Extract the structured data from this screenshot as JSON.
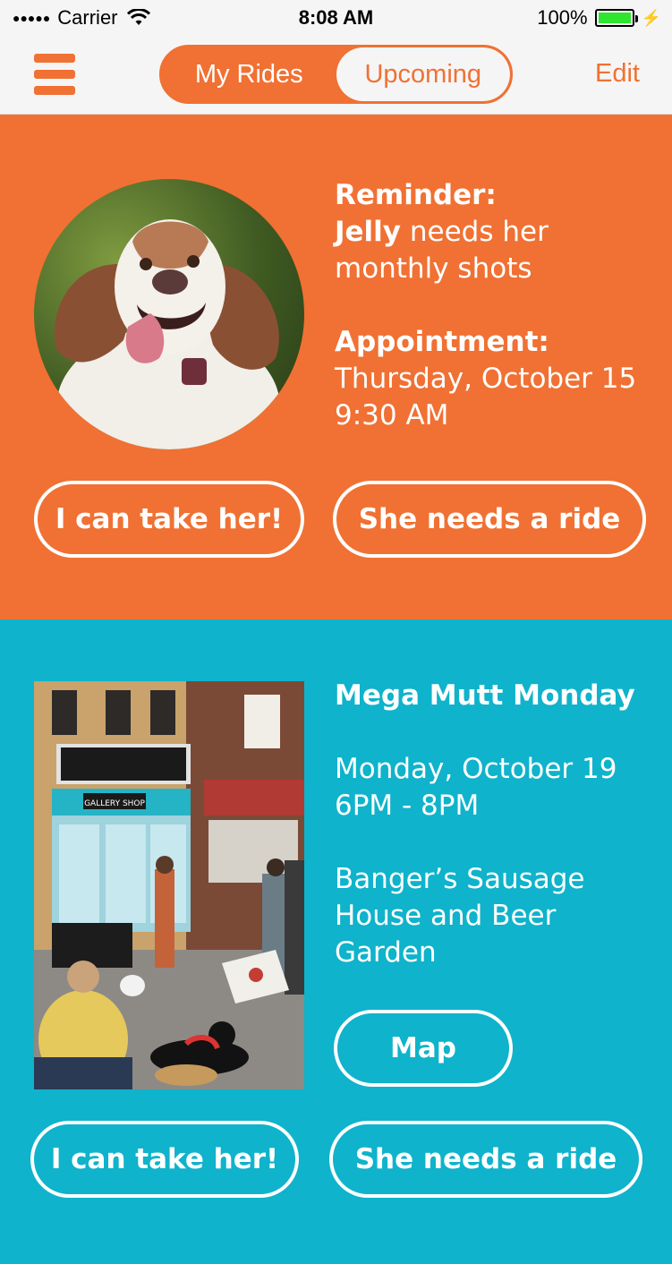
{
  "status_bar": {
    "signal": "●●●●●",
    "carrier": "Carrier",
    "wifi": "wifi-icon",
    "time": "8:08 AM",
    "battery_percent": "100%",
    "battery_level": 1.0
  },
  "nav": {
    "segment_my_rides": "My Rides",
    "segment_upcoming": "Upcoming",
    "edit_label": "Edit"
  },
  "reminder_card": {
    "reminder_heading": "Reminder:",
    "pet_name": "Jelly",
    "reminder_text": "needs her monthly shots",
    "appointment_heading": "Appointment:",
    "appointment_date": "Thursday, October 15",
    "appointment_time": "9:30 AM",
    "take_button": "I can take her!",
    "ride_button": "She needs a ride"
  },
  "event_card": {
    "title": "Mega Mutt Monday",
    "date": "Monday, October 19",
    "time": "6PM - 8PM",
    "location": "Banger’s Sausage House and Beer Garden",
    "map_button": "Map",
    "take_button": "I can take her!",
    "ride_button": "She needs a ride",
    "photo_sign": "GALLERY SHOP"
  },
  "colors": {
    "orange": "#f07133",
    "teal": "#0fb3cb",
    "white": "#ffffff",
    "light_gray": "#f5f5f5"
  }
}
